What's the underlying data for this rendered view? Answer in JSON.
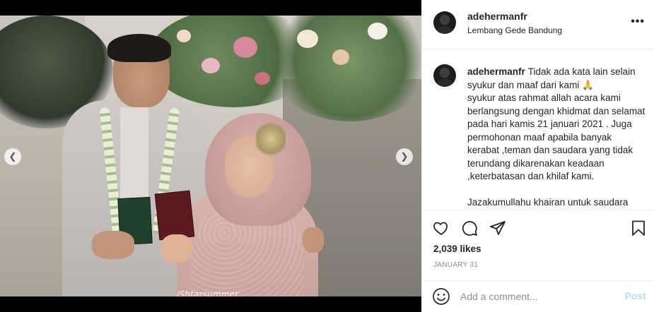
{
  "post": {
    "photo_watermark": "iShtarsummer",
    "nav_prev_icon": "chevron-left-icon",
    "nav_next_icon": "chevron-right-icon"
  },
  "header": {
    "username": "adehermanfr",
    "location": "Lembang Gede Bandung",
    "more_label": "•••"
  },
  "caption": {
    "username": "adehermanfr",
    "text": "Tidak ada kata lain selain syukur dan maaf dari kami 🙏\nsyukur atas rahmat allah acara kami berlangsung dengan khidmat dan selamat pada hari kamis 21 januari 2021 . Juga permohonan maaf apabila banyak kerabat ,teman dan saudara yang tidak terundang dikarenakan keadaan ,keterbatasan dan khilaf kami.\n\nJazakumullahu khairan untuk saudara"
  },
  "actions": {
    "likes": "2,039 likes",
    "date": "JANUARY 31"
  },
  "comment": {
    "placeholder": "Add a comment...",
    "post_label": "Post"
  },
  "colors": {
    "text": "#262626",
    "muted": "#8e8e8e",
    "post_disabled": "#b2dffc",
    "border": "#efefef"
  }
}
